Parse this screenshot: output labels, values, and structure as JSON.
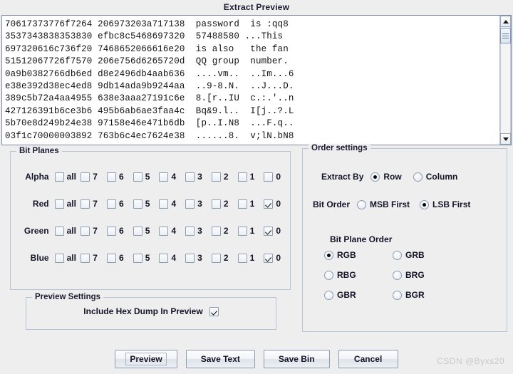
{
  "dialog": {
    "title": "Extract Preview"
  },
  "preview": {
    "lines": [
      "70617373776f7264 206973203a717138  password  is :qq8",
      "3537343838353830 efbc8c5468697320  57488580 ...This",
      "697320616c736f20 7468652066616e20  is also   the fan",
      "51512067726f7570 206e756d6265720d  QQ group  number.",
      "0a9b0382766db6ed d8e2496db4aab636  ....vm..  ..Im...6",
      "e38e392d38ec4ed8 9db14ada9b9244aa  ..9-8.N.  ..J...D.",
      "389c5b72a4aa4955 638e3aaa27191c6e  8.[r..IU  c.:.'..n",
      "427126391b6ce3b6 495b6ab6ae3faa4c  Bq&9.l..  I[j..?.L",
      "5b70e8d249b24e38 97158e46e471b6db  [p..I.N8  ...F.q..",
      "03f1c70000003892 763b6c4ec7624e38  ......8.  v;lN.bN8"
    ],
    "scrollbar": {
      "up_icon": "arrow-up-icon",
      "down_icon": "arrow-down-icon",
      "thumb_icon": "scroll-thumb"
    }
  },
  "bit_planes": {
    "title": "Bit Planes",
    "bit_labels": [
      "all",
      "7",
      "6",
      "5",
      "4",
      "3",
      "2",
      "1",
      "0"
    ],
    "rows": [
      {
        "channel": "Alpha",
        "checked": [
          false,
          false,
          false,
          false,
          false,
          false,
          false,
          false,
          false
        ]
      },
      {
        "channel": "Red",
        "checked": [
          false,
          false,
          false,
          false,
          false,
          false,
          false,
          false,
          true
        ]
      },
      {
        "channel": "Green",
        "checked": [
          false,
          false,
          false,
          false,
          false,
          false,
          false,
          false,
          true
        ]
      },
      {
        "channel": "Blue",
        "checked": [
          false,
          false,
          false,
          false,
          false,
          false,
          false,
          false,
          true
        ]
      }
    ]
  },
  "order_settings": {
    "title": "Order settings",
    "extract_by": {
      "label": "Extract By",
      "options": [
        "Row",
        "Column"
      ],
      "selected": "Row"
    },
    "bit_order": {
      "label": "Bit Order",
      "options": [
        "MSB First",
        "LSB First"
      ],
      "selected": "LSB First"
    },
    "bit_plane_order": {
      "label": "Bit Plane Order",
      "options": [
        "RGB",
        "GRB",
        "RBG",
        "BRG",
        "GBR",
        "BGR"
      ],
      "selected": "RGB"
    }
  },
  "preview_settings": {
    "title": "Preview Settings",
    "include_hex_dump": {
      "label": "Include Hex Dump In Preview",
      "checked": true
    }
  },
  "buttons": [
    {
      "label": "Preview",
      "focused": true
    },
    {
      "label": "Save Text",
      "focused": false
    },
    {
      "label": "Save Bin",
      "focused": false
    },
    {
      "label": "Cancel",
      "focused": false
    }
  ],
  "watermark": "CSDN @Byxs20",
  "colors": {
    "dialog_background": "#eeeeee",
    "panel_border": "#b8c4d4",
    "text_area_background": "#ffffff",
    "label_text": "#141428",
    "watermark_text": "#c9c9c9"
  }
}
